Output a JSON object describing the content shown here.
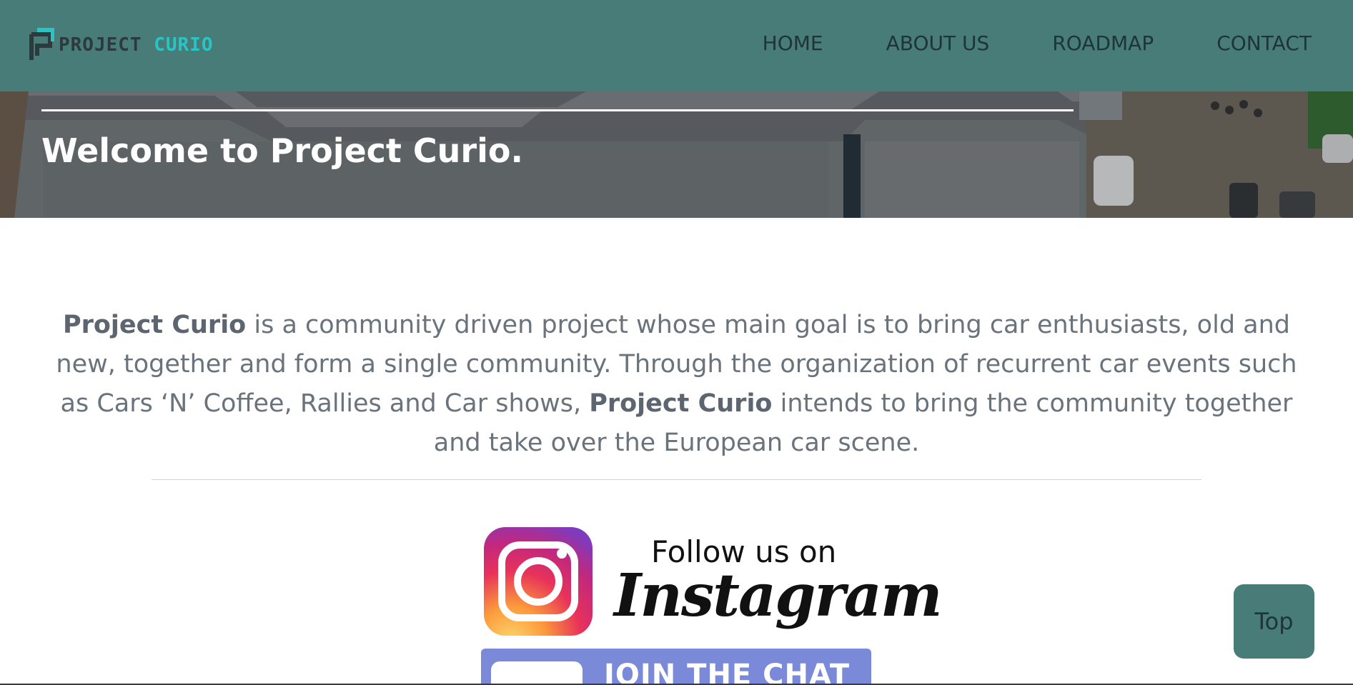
{
  "brand": {
    "word1": "PROJECT",
    "word2": "CURIO",
    "colors": {
      "nav_bg": "#487c78",
      "accent": "#2ac4c4",
      "dark": "#2c3a3e"
    }
  },
  "nav": {
    "items": [
      {
        "label": "HOME"
      },
      {
        "label": "ABOUT US"
      },
      {
        "label": "ROADMAP"
      },
      {
        "label": "CONTACT"
      }
    ]
  },
  "hero": {
    "title_prefix": "Welcome to ",
    "title_strong": "Project Curio",
    "title_suffix": "."
  },
  "intro": {
    "strong1": "Project Curio",
    "text1": " is a community driven project whose main goal is to bring car enthusiasts, old and new, together and form a single community. Through the organization of recurrent car events such as Cars ‘N’ Coffee, Rallies and Car shows, ",
    "strong2": "Project Curio",
    "text2": " intends to bring the community together and take over the European car scene."
  },
  "instagram_banner": {
    "icon": "instagram-icon",
    "line1": "Follow us on",
    "line2": "Instagram"
  },
  "chat_banner": {
    "label": "JOIN THE CHAT",
    "color": "#7a8ad8"
  },
  "top_button": {
    "label": "Top"
  }
}
